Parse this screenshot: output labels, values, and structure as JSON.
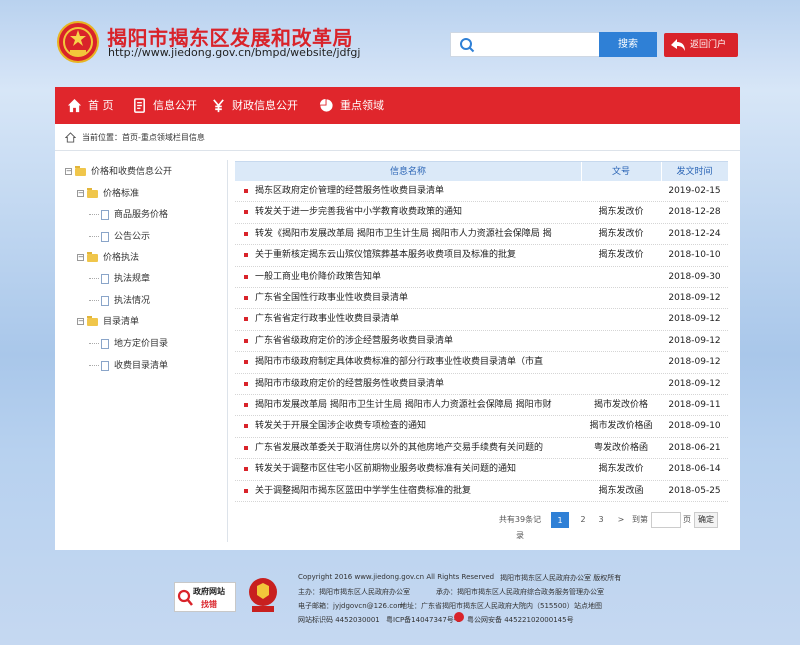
{
  "header": {
    "title": "揭阳市揭东区发展和改革局",
    "url": "http://www.jiedong.gov.cn/bmpd/website/jdfgj",
    "search_placeholder": "",
    "search_button": "搜索",
    "back_button": "返回门户"
  },
  "nav": {
    "items": [
      {
        "label": "首 页",
        "icon": "home-icon"
      },
      {
        "label": "信息公开",
        "icon": "document-icon"
      },
      {
        "label": "财政信息公开",
        "icon": "yen-icon"
      },
      {
        "label": "重点领域",
        "icon": "pie-chart-icon"
      }
    ]
  },
  "breadcrumb": {
    "text": "当前位置：首页-重点领域栏目信息"
  },
  "tree": {
    "root": "价格和收费信息公开",
    "groups": [
      {
        "label": "价格标准",
        "children": [
          "商品服务价格",
          "公告公示"
        ]
      },
      {
        "label": "价格执法",
        "children": [
          "执法规章",
          "执法情况"
        ]
      },
      {
        "label": "目录清单",
        "children": [
          "地方定价目录",
          "收费目录清单"
        ]
      }
    ]
  },
  "table": {
    "headers": [
      "信息名称",
      "文号",
      "发文时间"
    ],
    "rows": [
      {
        "title": "揭东区政府定价管理的经营服务性收费目录清单",
        "docno": "",
        "date": "2019-02-15"
      },
      {
        "title": "转发关于进一步完善我省中小学教育收费政策的通知",
        "docno": "揭东发改价",
        "date": "2018-12-28"
      },
      {
        "title": "转发《揭阳市发展改革局 揭阳市卫生计生局 揭阳市人力资源社会保障局 揭",
        "docno": "揭东发改价",
        "date": "2018-12-24"
      },
      {
        "title": "关于重新核定揭东云山殡仪馆殡葬基本服务收费项目及标准的批复",
        "docno": "揭东发改价",
        "date": "2018-10-10"
      },
      {
        "title": "一般工商业电价降价政策告知单",
        "docno": "",
        "date": "2018-09-30"
      },
      {
        "title": "广东省全国性行政事业性收费目录清单",
        "docno": "",
        "date": "2018-09-12"
      },
      {
        "title": "广东省省定行政事业性收费目录清单",
        "docno": "",
        "date": "2018-09-12"
      },
      {
        "title": "广东省省级政府定价的涉企经营服务收费目录清单",
        "docno": "",
        "date": "2018-09-12"
      },
      {
        "title": "揭阳市市级政府制定具体收费标准的部分行政事业性收费目录清单（市直",
        "docno": "",
        "date": "2018-09-12"
      },
      {
        "title": "揭阳市市级政府定价的经营服务性收费目录清单",
        "docno": "",
        "date": "2018-09-12"
      },
      {
        "title": "揭阳市发展改革局 揭阳市卫生计生局 揭阳市人力资源社会保障局 揭阳市财",
        "docno": "揭市发改价格",
        "date": "2018-09-11"
      },
      {
        "title": "转发关于开展全国涉企收费专项检查的通知",
        "docno": "揭市发改价格函",
        "date": "2018-09-10"
      },
      {
        "title": "广东省发展改革委关于取消住房以外的其他房地产交易手续费有关问题的",
        "docno": "粤发改价格函",
        "date": "2018-06-21"
      },
      {
        "title": "转发关于调整市区住宅小区前期物业服务收费标准有关问题的通知",
        "docno": "揭东发改价",
        "date": "2018-06-14"
      },
      {
        "title": "关于调整揭阳市揭东区蓝田中学学生住宿费标准的批复",
        "docno": "揭东发改函",
        "date": "2018-05-25"
      }
    ]
  },
  "pager": {
    "total_text": "共有39条记录",
    "pages": [
      "1",
      "2",
      "3",
      ">"
    ],
    "current": "1",
    "jump_label": "到第",
    "page_unit": "页",
    "ok_label": "确定"
  },
  "footer": {
    "badge_title": "政府网站",
    "badge_action": "找错",
    "line1_a": "Copyright 2016 www.jiedong.gov.cn All Rights Reserved",
    "line1_b": "揭阳市揭东区人民政府办公室 版权所有",
    "line2_a": "主办：揭阳市揭东区人民政府办公室",
    "line2_b": "承办：揭阳市揭东区人民政府综合政务服务管理办公室",
    "line3_a": "电子邮箱：jyjdgovcn@126.com",
    "line3_b": "地址：广东省揭阳市揭东区人民政府大院内（515500）",
    "line3_c": "站点地图",
    "line4_a": "网站标识码 4452030001",
    "line4_b": "粤ICP备14047347号-1",
    "line4_c": "粤公网安备 44522102000145号"
  },
  "colors": {
    "brand_red": "#e0262c",
    "accent_blue": "#2f80d6",
    "header_blue": "#dbe9f8"
  }
}
